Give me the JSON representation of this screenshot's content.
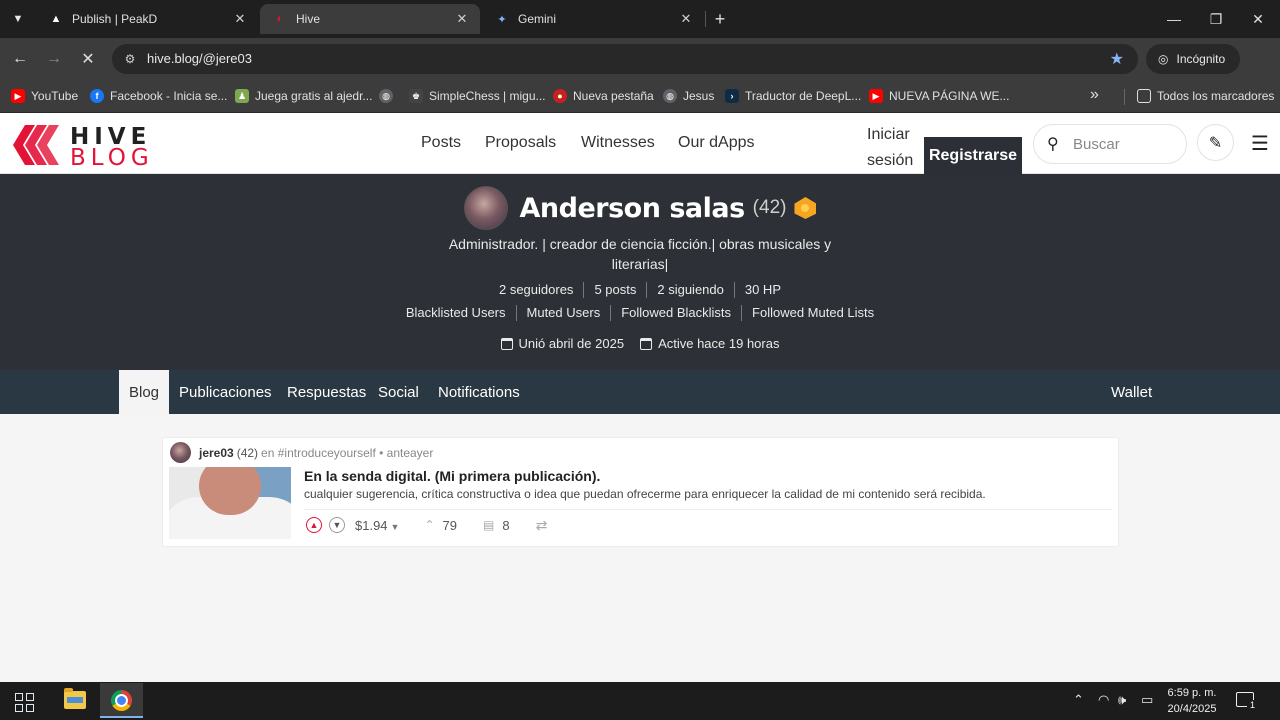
{
  "browser": {
    "tabs": [
      {
        "title": "Publish | PeakD",
        "icon": "peakd-icon"
      },
      {
        "title": "Hive",
        "icon": "hive-icon"
      },
      {
        "title": "Gemini",
        "icon": "gemini-icon"
      }
    ],
    "url": "hive.blog/@jere03",
    "incognito_label": "Incógnito",
    "bookmarks": [
      "YouTube",
      "Facebook - Inicia se...",
      "Juega gratis al ajedr...",
      "SimpleChess | migu...",
      "Nueva pestaña",
      "Jesus",
      "Traductor de DeepL...",
      "NUEVA PÁGINA WE...",
      "Todos los marcadores"
    ]
  },
  "header": {
    "logo_top": "HIVE",
    "logo_bottom": "BLOG",
    "nav": [
      "Posts",
      "Proposals",
      "Witnesses",
      "Our dApps"
    ],
    "login_label": "Iniciar sesión",
    "register_label": "Registrarse",
    "search_placeholder": "Buscar"
  },
  "profile": {
    "name": "Anderson salas",
    "reputation": "(42)",
    "bio": "Administrador. | creador de ciencia ficción.| obras musicales y literarias|",
    "stats": [
      "2 seguidores",
      "5 posts",
      "2 siguiendo",
      "30 HP"
    ],
    "lists": [
      "Blacklisted Users",
      "Muted Users",
      "Followed Blacklists",
      "Followed Muted Lists"
    ],
    "joined": "Unió abril de 2025",
    "active": "Active hace 19 horas"
  },
  "profile_tabs": {
    "items": [
      "Blog",
      "Publicaciones",
      "Respuestas",
      "Social",
      "Notifications"
    ],
    "wallet": "Wallet"
  },
  "post": {
    "author": "jere03",
    "reputation": "(42)",
    "meta_rest": "en #introduceyourself • anteayer",
    "title": "En la senda digital. (Mi primera publicación).",
    "summary": "cualquier sugerencia, crítica constructiva o idea que puedan ofrecerme para enriquecer la calidad de mi contenido será recibida.",
    "payout": "$1.94",
    "votes": "79",
    "comments": "8"
  },
  "taskbar": {
    "time": "6:59 p. m.",
    "date": "20/4/2025",
    "notifications": "1"
  },
  "colors": {
    "hive_red": "#e31337",
    "banner": "#2d3036",
    "tabs_bar": "#293843"
  }
}
